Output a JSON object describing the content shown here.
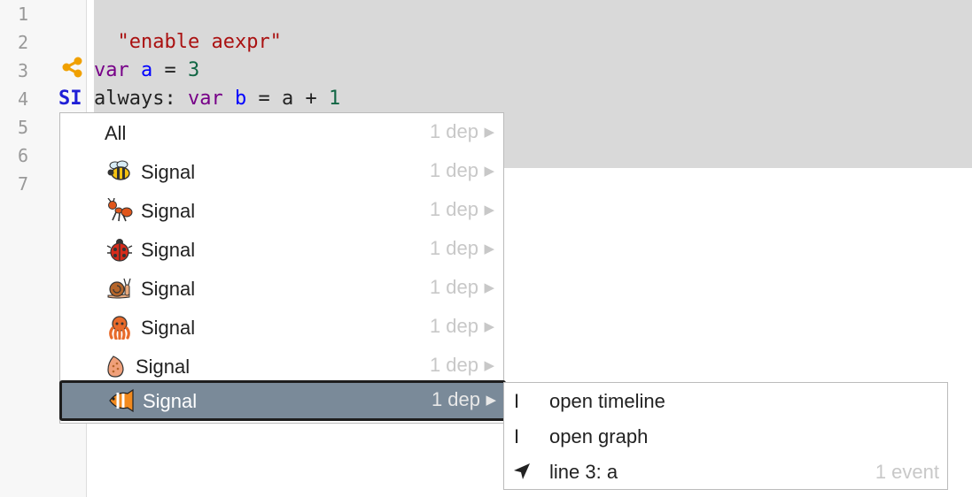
{
  "editor": {
    "line_numbers": [
      "1",
      "2",
      "3",
      "4",
      "5",
      "6",
      "7"
    ],
    "line1": {
      "string": "\"enable aexpr\""
    },
    "line3": {
      "kw": "var",
      "name": "a",
      "op": " = ",
      "num": "3"
    },
    "line4": {
      "prefix": "always: ",
      "kw": "var",
      "name": "b",
      "op": " = a + ",
      "num": "1"
    },
    "gutter": {
      "si_marker": "SI",
      "share_icon": "share-nodes-icon",
      "share_color": "#f0a000"
    }
  },
  "dependency_menu": {
    "arrow": "▶",
    "items": [
      {
        "label": "All",
        "deps": "1 dep",
        "icon": ""
      },
      {
        "label": "Signal",
        "deps": "1 dep",
        "icon": "bee-icon"
      },
      {
        "label": "Signal",
        "deps": "1 dep",
        "icon": "ant-icon"
      },
      {
        "label": "Signal",
        "deps": "1 dep",
        "icon": "ladybug-icon"
      },
      {
        "label": "Signal",
        "deps": "1 dep",
        "icon": "snail-icon"
      },
      {
        "label": "Signal",
        "deps": "1 dep",
        "icon": "octopus-icon"
      },
      {
        "label": "Signal",
        "deps": "1 dep",
        "icon": "shell-icon"
      },
      {
        "label": "Signal",
        "deps": "1 dep",
        "icon": "tropical-fish-icon",
        "selected": true
      }
    ],
    "selected_color": "#7a8a99"
  },
  "submenu": {
    "items": [
      {
        "marker": "I",
        "label": "open timeline"
      },
      {
        "marker": "I",
        "label": "open graph"
      },
      {
        "icon": "location-arrow-icon",
        "label": "line 3: a",
        "count": "1 event"
      }
    ]
  }
}
